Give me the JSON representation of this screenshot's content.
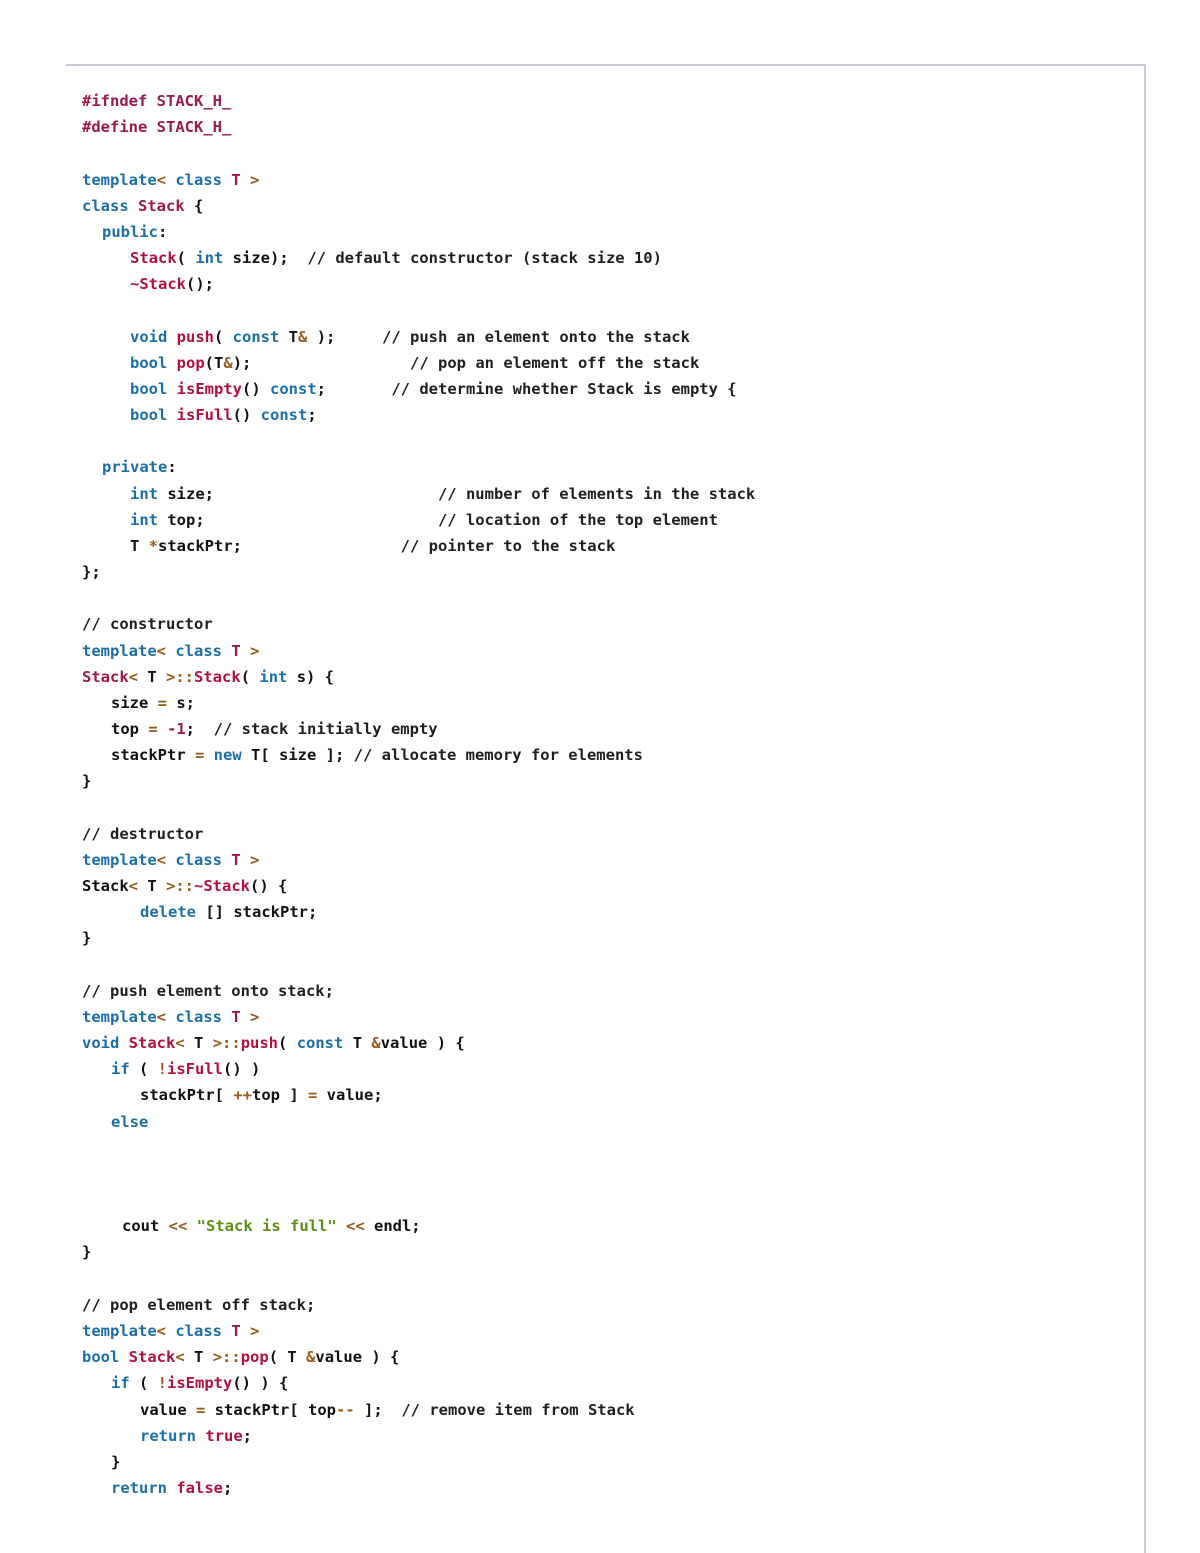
{
  "document": {
    "lines": [
      {
        "indent": 0,
        "tokens": [
          {
            "t": "#ifndef STACK_H_",
            "c": "pp"
          }
        ]
      },
      {
        "indent": 0,
        "tokens": [
          {
            "t": "#define STACK_H_",
            "c": "pp"
          }
        ]
      },
      null,
      {
        "indent": 0,
        "tokens": [
          {
            "t": "template",
            "c": "kw"
          },
          {
            "t": "< ",
            "c": "op"
          },
          {
            "t": "class ",
            "c": "kw"
          },
          {
            "t": "T",
            "c": "ty"
          },
          {
            "t": " >",
            "c": "op"
          }
        ]
      },
      {
        "indent": 0,
        "tokens": [
          {
            "t": "class ",
            "c": "kw"
          },
          {
            "t": "Stack",
            "c": "ty"
          },
          {
            "t": " {",
            "c": "tx"
          }
        ]
      },
      {
        "indent": 1,
        "tokens": [
          {
            "t": "public",
            "c": "kw"
          },
          {
            "t": ":",
            "c": "tx"
          }
        ]
      },
      {
        "indent": 2,
        "tokens": [
          {
            "t": "Stack",
            "c": "fn"
          },
          {
            "t": "( ",
            "c": "tx"
          },
          {
            "t": "int ",
            "c": "kw"
          },
          {
            "t": "size);  ",
            "c": "tx"
          },
          {
            "t": "// default constructor (stack size 10)",
            "c": "cm"
          }
        ]
      },
      {
        "indent": 2,
        "tokens": [
          {
            "t": "~Stack",
            "c": "fn"
          },
          {
            "t": "();",
            "c": "tx"
          }
        ]
      },
      null,
      {
        "indent": 2,
        "tokens": [
          {
            "t": "void ",
            "c": "kw"
          },
          {
            "t": "push",
            "c": "fn"
          },
          {
            "t": "( ",
            "c": "tx"
          },
          {
            "t": "const ",
            "c": "kw"
          },
          {
            "t": "T",
            "c": "tx"
          },
          {
            "t": "&",
            "c": "op"
          },
          {
            "t": " );     ",
            "c": "tx"
          },
          {
            "t": "// push an element onto the stack",
            "c": "cm"
          }
        ]
      },
      {
        "indent": 2,
        "tokens": [
          {
            "t": "bool ",
            "c": "kw"
          },
          {
            "t": "pop",
            "c": "fn"
          },
          {
            "t": "(T",
            "c": "tx"
          },
          {
            "t": "&",
            "c": "op"
          },
          {
            "t": ");                 ",
            "c": "tx"
          },
          {
            "t": "// pop an element off the stack",
            "c": "cm"
          }
        ]
      },
      {
        "indent": 2,
        "tokens": [
          {
            "t": "bool ",
            "c": "kw"
          },
          {
            "t": "isEmpty",
            "c": "fn"
          },
          {
            "t": "() ",
            "c": "tx"
          },
          {
            "t": "const",
            "c": "kw"
          },
          {
            "t": ";       ",
            "c": "tx"
          },
          {
            "t": "// determine whether Stack is empty {",
            "c": "cm"
          }
        ]
      },
      {
        "indent": 2,
        "tokens": [
          {
            "t": "bool ",
            "c": "kw"
          },
          {
            "t": "isFull",
            "c": "fn"
          },
          {
            "t": "() ",
            "c": "tx"
          },
          {
            "t": "const",
            "c": "kw"
          },
          {
            "t": ";",
            "c": "tx"
          }
        ]
      },
      null,
      {
        "indent": 1,
        "tokens": [
          {
            "t": "private",
            "c": "kw"
          },
          {
            "t": ":",
            "c": "tx"
          }
        ]
      },
      {
        "indent": 2,
        "tokens": [
          {
            "t": "int ",
            "c": "kw"
          },
          {
            "t": "size;                        ",
            "c": "tx"
          },
          {
            "t": "// number of elements in the stack",
            "c": "cm"
          }
        ]
      },
      {
        "indent": 2,
        "tokens": [
          {
            "t": "int ",
            "c": "kw"
          },
          {
            "t": "top;                         ",
            "c": "tx"
          },
          {
            "t": "// location of the top element",
            "c": "cm"
          }
        ]
      },
      {
        "indent": 2,
        "tokens": [
          {
            "t": "T ",
            "c": "tx"
          },
          {
            "t": "*",
            "c": "op"
          },
          {
            "t": "stackPtr;                 ",
            "c": "tx"
          },
          {
            "t": "// pointer to the stack",
            "c": "cm"
          }
        ]
      },
      {
        "indent": 0,
        "tokens": [
          {
            "t": "};",
            "c": "tx"
          }
        ]
      },
      null,
      {
        "indent": 0,
        "tokens": [
          {
            "t": "// constructor",
            "c": "cm"
          }
        ]
      },
      {
        "indent": 0,
        "tokens": [
          {
            "t": "template",
            "c": "kw"
          },
          {
            "t": "< ",
            "c": "op"
          },
          {
            "t": "class ",
            "c": "kw"
          },
          {
            "t": "T",
            "c": "ty"
          },
          {
            "t": " >",
            "c": "op"
          }
        ]
      },
      {
        "indent": 0,
        "tokens": [
          {
            "t": "Stack",
            "c": "ty"
          },
          {
            "t": "< ",
            "c": "op"
          },
          {
            "t": "T ",
            "c": "tx"
          },
          {
            "t": ">::",
            "c": "op"
          },
          {
            "t": "Stack",
            "c": "fn"
          },
          {
            "t": "( ",
            "c": "tx"
          },
          {
            "t": "int ",
            "c": "kw"
          },
          {
            "t": "s) {",
            "c": "tx"
          }
        ]
      },
      {
        "indent": 3,
        "tokens": [
          {
            "t": "size ",
            "c": "tx"
          },
          {
            "t": "= ",
            "c": "op"
          },
          {
            "t": "s;",
            "c": "tx"
          }
        ]
      },
      {
        "indent": 3,
        "tokens": [
          {
            "t": "top ",
            "c": "tx"
          },
          {
            "t": "= ",
            "c": "op"
          },
          {
            "t": "-1",
            "c": "num"
          },
          {
            "t": ";  ",
            "c": "tx"
          },
          {
            "t": "// stack initially empty",
            "c": "cm"
          }
        ]
      },
      {
        "indent": 3,
        "tokens": [
          {
            "t": "stackPtr ",
            "c": "tx"
          },
          {
            "t": "= ",
            "c": "op"
          },
          {
            "t": "new ",
            "c": "kw"
          },
          {
            "t": "T[ size ]; ",
            "c": "tx"
          },
          {
            "t": "// allocate memory for elements",
            "c": "cm"
          }
        ]
      },
      {
        "indent": 0,
        "tokens": [
          {
            "t": "}",
            "c": "tx"
          }
        ]
      },
      null,
      {
        "indent": 0,
        "tokens": [
          {
            "t": "// destructor",
            "c": "cm"
          }
        ]
      },
      {
        "indent": 0,
        "tokens": [
          {
            "t": "template",
            "c": "kw"
          },
          {
            "t": "< ",
            "c": "op"
          },
          {
            "t": "class ",
            "c": "kw"
          },
          {
            "t": "T",
            "c": "ty"
          },
          {
            "t": " >",
            "c": "op"
          }
        ]
      },
      {
        "indent": 0,
        "tokens": [
          {
            "t": "Stack",
            "c": "tx"
          },
          {
            "t": "< ",
            "c": "op"
          },
          {
            "t": "T ",
            "c": "tx"
          },
          {
            "t": ">::",
            "c": "op"
          },
          {
            "t": "~Stack",
            "c": "fn"
          },
          {
            "t": "() {",
            "c": "tx"
          }
        ]
      },
      {
        "indent": 5,
        "tokens": [
          {
            "t": "delete ",
            "c": "kw"
          },
          {
            "t": "[] stackPtr;",
            "c": "tx"
          }
        ]
      },
      {
        "indent": 0,
        "tokens": [
          {
            "t": "}",
            "c": "tx"
          }
        ]
      },
      null,
      {
        "indent": 0,
        "tokens": [
          {
            "t": "// push element onto stack;",
            "c": "cm"
          }
        ]
      },
      {
        "indent": 0,
        "tokens": [
          {
            "t": "template",
            "c": "kw"
          },
          {
            "t": "< ",
            "c": "op"
          },
          {
            "t": "class ",
            "c": "kw"
          },
          {
            "t": "T",
            "c": "ty"
          },
          {
            "t": " >",
            "c": "op"
          }
        ]
      },
      {
        "indent": 0,
        "tokens": [
          {
            "t": "void ",
            "c": "kw"
          },
          {
            "t": "Stack",
            "c": "fn"
          },
          {
            "t": "< ",
            "c": "op"
          },
          {
            "t": "T ",
            "c": "tx"
          },
          {
            "t": ">::",
            "c": "op"
          },
          {
            "t": "push",
            "c": "fn"
          },
          {
            "t": "( ",
            "c": "tx"
          },
          {
            "t": "const ",
            "c": "kw"
          },
          {
            "t": "T ",
            "c": "tx"
          },
          {
            "t": "&",
            "c": "op"
          },
          {
            "t": "value ) {",
            "c": "tx"
          }
        ]
      },
      {
        "indent": 3,
        "tokens": [
          {
            "t": "if ",
            "c": "kw"
          },
          {
            "t": "( ",
            "c": "tx"
          },
          {
            "t": "!",
            "c": "op"
          },
          {
            "t": "isFull",
            "c": "fn"
          },
          {
            "t": "() )",
            "c": "tx"
          }
        ]
      },
      {
        "indent": 6,
        "tokens": [
          {
            "t": "stackPtr[ ",
            "c": "tx"
          },
          {
            "t": "++",
            "c": "op"
          },
          {
            "t": "top ] ",
            "c": "tx"
          },
          {
            "t": "= ",
            "c": "op"
          },
          {
            "t": "value;",
            "c": "tx"
          }
        ]
      },
      {
        "indent": 3,
        "tokens": [
          {
            "t": "else",
            "c": "kw"
          }
        ]
      },
      null,
      null,
      null,
      {
        "indent": 4,
        "tokens": [
          {
            "t": "cout ",
            "c": "tx"
          },
          {
            "t": "<< ",
            "c": "op"
          },
          {
            "t": "\"Stack is full\"",
            "c": "st"
          },
          {
            "t": " << ",
            "c": "op"
          },
          {
            "t": "endl;",
            "c": "tx"
          }
        ]
      },
      {
        "indent": 0,
        "tokens": [
          {
            "t": "}",
            "c": "tx"
          }
        ]
      },
      null,
      {
        "indent": 0,
        "tokens": [
          {
            "t": "// pop element off stack;",
            "c": "cm"
          }
        ]
      },
      {
        "indent": 0,
        "tokens": [
          {
            "t": "template",
            "c": "kw"
          },
          {
            "t": "< ",
            "c": "op"
          },
          {
            "t": "class ",
            "c": "kw"
          },
          {
            "t": "T",
            "c": "ty"
          },
          {
            "t": " >",
            "c": "op"
          }
        ]
      },
      {
        "indent": 0,
        "tokens": [
          {
            "t": "bool ",
            "c": "kw"
          },
          {
            "t": "Stack",
            "c": "fn"
          },
          {
            "t": "< ",
            "c": "op"
          },
          {
            "t": "T ",
            "c": "tx"
          },
          {
            "t": ">::",
            "c": "op"
          },
          {
            "t": "pop",
            "c": "fn"
          },
          {
            "t": "( ",
            "c": "tx"
          },
          {
            "t": "T ",
            "c": "tx"
          },
          {
            "t": "&",
            "c": "op"
          },
          {
            "t": "value ) {",
            "c": "tx"
          }
        ]
      },
      {
        "indent": 3,
        "tokens": [
          {
            "t": "if ",
            "c": "kw"
          },
          {
            "t": "( ",
            "c": "tx"
          },
          {
            "t": "!",
            "c": "op"
          },
          {
            "t": "isEmpty",
            "c": "fn"
          },
          {
            "t": "() ) {",
            "c": "tx"
          }
        ]
      },
      {
        "indent": 6,
        "tokens": [
          {
            "t": "value ",
            "c": "tx"
          },
          {
            "t": "= ",
            "c": "op"
          },
          {
            "t": "stackPtr[ top",
            "c": "tx"
          },
          {
            "t": "-- ",
            "c": "op"
          },
          {
            "t": "];  ",
            "c": "tx"
          },
          {
            "t": "// remove item from Stack",
            "c": "cm"
          }
        ]
      },
      {
        "indent": 6,
        "tokens": [
          {
            "t": "return ",
            "c": "kw"
          },
          {
            "t": "true",
            "c": "fn"
          },
          {
            "t": ";",
            "c": "tx"
          }
        ]
      },
      {
        "indent": 3,
        "tokens": [
          {
            "t": "}",
            "c": "tx"
          }
        ]
      },
      {
        "indent": 3,
        "tokens": [
          {
            "t": "return ",
            "c": "kw"
          },
          {
            "t": "false",
            "c": "fn"
          },
          {
            "t": ";",
            "c": "tx"
          }
        ]
      }
    ]
  }
}
